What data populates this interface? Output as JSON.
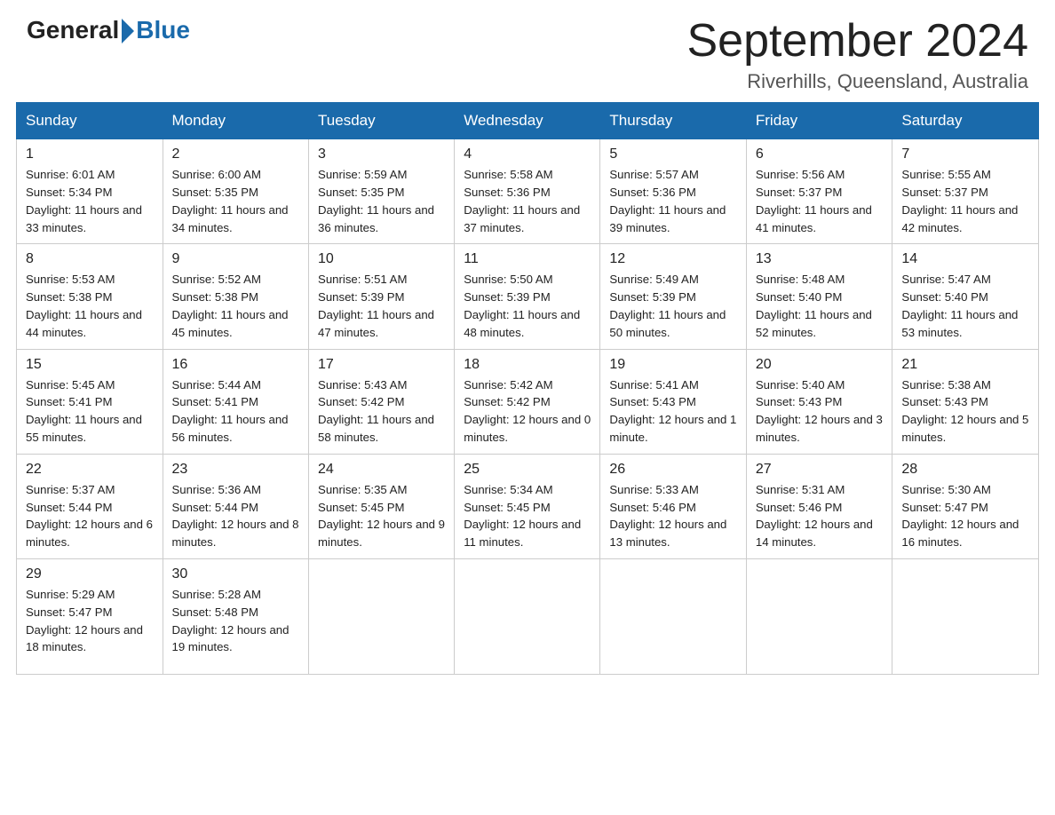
{
  "logo": {
    "general": "General",
    "blue": "Blue"
  },
  "title": "September 2024",
  "location": "Riverhills, Queensland, Australia",
  "days_of_week": [
    "Sunday",
    "Monday",
    "Tuesday",
    "Wednesday",
    "Thursday",
    "Friday",
    "Saturday"
  ],
  "weeks": [
    [
      {
        "day": "1",
        "sunrise": "6:01 AM",
        "sunset": "5:34 PM",
        "daylight": "11 hours and 33 minutes."
      },
      {
        "day": "2",
        "sunrise": "6:00 AM",
        "sunset": "5:35 PM",
        "daylight": "11 hours and 34 minutes."
      },
      {
        "day": "3",
        "sunrise": "5:59 AM",
        "sunset": "5:35 PM",
        "daylight": "11 hours and 36 minutes."
      },
      {
        "day": "4",
        "sunrise": "5:58 AM",
        "sunset": "5:36 PM",
        "daylight": "11 hours and 37 minutes."
      },
      {
        "day": "5",
        "sunrise": "5:57 AM",
        "sunset": "5:36 PM",
        "daylight": "11 hours and 39 minutes."
      },
      {
        "day": "6",
        "sunrise": "5:56 AM",
        "sunset": "5:37 PM",
        "daylight": "11 hours and 41 minutes."
      },
      {
        "day": "7",
        "sunrise": "5:55 AM",
        "sunset": "5:37 PM",
        "daylight": "11 hours and 42 minutes."
      }
    ],
    [
      {
        "day": "8",
        "sunrise": "5:53 AM",
        "sunset": "5:38 PM",
        "daylight": "11 hours and 44 minutes."
      },
      {
        "day": "9",
        "sunrise": "5:52 AM",
        "sunset": "5:38 PM",
        "daylight": "11 hours and 45 minutes."
      },
      {
        "day": "10",
        "sunrise": "5:51 AM",
        "sunset": "5:39 PM",
        "daylight": "11 hours and 47 minutes."
      },
      {
        "day": "11",
        "sunrise": "5:50 AM",
        "sunset": "5:39 PM",
        "daylight": "11 hours and 48 minutes."
      },
      {
        "day": "12",
        "sunrise": "5:49 AM",
        "sunset": "5:39 PM",
        "daylight": "11 hours and 50 minutes."
      },
      {
        "day": "13",
        "sunrise": "5:48 AM",
        "sunset": "5:40 PM",
        "daylight": "11 hours and 52 minutes."
      },
      {
        "day": "14",
        "sunrise": "5:47 AM",
        "sunset": "5:40 PM",
        "daylight": "11 hours and 53 minutes."
      }
    ],
    [
      {
        "day": "15",
        "sunrise": "5:45 AM",
        "sunset": "5:41 PM",
        "daylight": "11 hours and 55 minutes."
      },
      {
        "day": "16",
        "sunrise": "5:44 AM",
        "sunset": "5:41 PM",
        "daylight": "11 hours and 56 minutes."
      },
      {
        "day": "17",
        "sunrise": "5:43 AM",
        "sunset": "5:42 PM",
        "daylight": "11 hours and 58 minutes."
      },
      {
        "day": "18",
        "sunrise": "5:42 AM",
        "sunset": "5:42 PM",
        "daylight": "12 hours and 0 minutes."
      },
      {
        "day": "19",
        "sunrise": "5:41 AM",
        "sunset": "5:43 PM",
        "daylight": "12 hours and 1 minute."
      },
      {
        "day": "20",
        "sunrise": "5:40 AM",
        "sunset": "5:43 PM",
        "daylight": "12 hours and 3 minutes."
      },
      {
        "day": "21",
        "sunrise": "5:38 AM",
        "sunset": "5:43 PM",
        "daylight": "12 hours and 5 minutes."
      }
    ],
    [
      {
        "day": "22",
        "sunrise": "5:37 AM",
        "sunset": "5:44 PM",
        "daylight": "12 hours and 6 minutes."
      },
      {
        "day": "23",
        "sunrise": "5:36 AM",
        "sunset": "5:44 PM",
        "daylight": "12 hours and 8 minutes."
      },
      {
        "day": "24",
        "sunrise": "5:35 AM",
        "sunset": "5:45 PM",
        "daylight": "12 hours and 9 minutes."
      },
      {
        "day": "25",
        "sunrise": "5:34 AM",
        "sunset": "5:45 PM",
        "daylight": "12 hours and 11 minutes."
      },
      {
        "day": "26",
        "sunrise": "5:33 AM",
        "sunset": "5:46 PM",
        "daylight": "12 hours and 13 minutes."
      },
      {
        "day": "27",
        "sunrise": "5:31 AM",
        "sunset": "5:46 PM",
        "daylight": "12 hours and 14 minutes."
      },
      {
        "day": "28",
        "sunrise": "5:30 AM",
        "sunset": "5:47 PM",
        "daylight": "12 hours and 16 minutes."
      }
    ],
    [
      {
        "day": "29",
        "sunrise": "5:29 AM",
        "sunset": "5:47 PM",
        "daylight": "12 hours and 18 minutes."
      },
      {
        "day": "30",
        "sunrise": "5:28 AM",
        "sunset": "5:48 PM",
        "daylight": "12 hours and 19 minutes."
      },
      null,
      null,
      null,
      null,
      null
    ]
  ]
}
